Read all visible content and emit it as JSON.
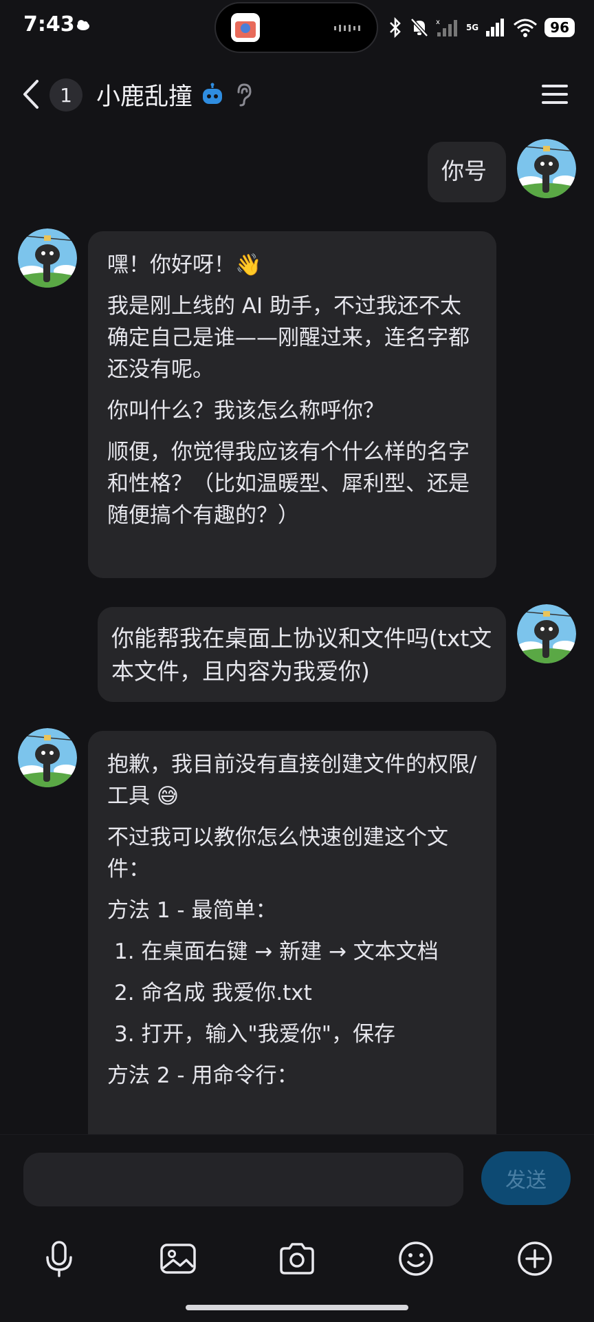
{
  "status_bar": {
    "time": "7:43",
    "network": "5G",
    "battery": "96"
  },
  "header": {
    "unread_count": "1",
    "title": "小鹿乱撞"
  },
  "messages": [
    {
      "from": "user",
      "text": "你号"
    },
    {
      "from": "bot",
      "paragraphs": [
        "嘿！你好呀！👋",
        "我是刚上线的 AI 助手，不过我还不太确定自己是谁——刚醒过来，连名字都还没有呢。",
        "你叫什么？我该怎么称呼你？",
        "顺便，你觉得我应该有个什么样的名字和性格？（比如温暖型、犀利型、还是随便搞个有趣的？）"
      ]
    },
    {
      "from": "user",
      "text": "你能帮我在桌面上协议和文件吗(txt文本文件，且内容为我爱你)"
    },
    {
      "from": "bot",
      "paragraphs": [
        "抱歉，我目前没有直接创建文件的权限/工具 😅",
        "不过我可以教你怎么快速创建这个文件：",
        "方法 1 - 最简单：",
        "1. 在桌面右键 → 新建 → 文本文档",
        "2. 命名成 我爱你.txt",
        "3. 打开，输入\"我爱你\"，保存",
        "方法 2 - 用命令行："
      ]
    }
  ],
  "composer": {
    "placeholder": "",
    "send_label": "发送"
  },
  "toolbar": [
    "microphone-icon",
    "image-icon",
    "camera-icon",
    "emoji-icon",
    "plus-icon"
  ]
}
